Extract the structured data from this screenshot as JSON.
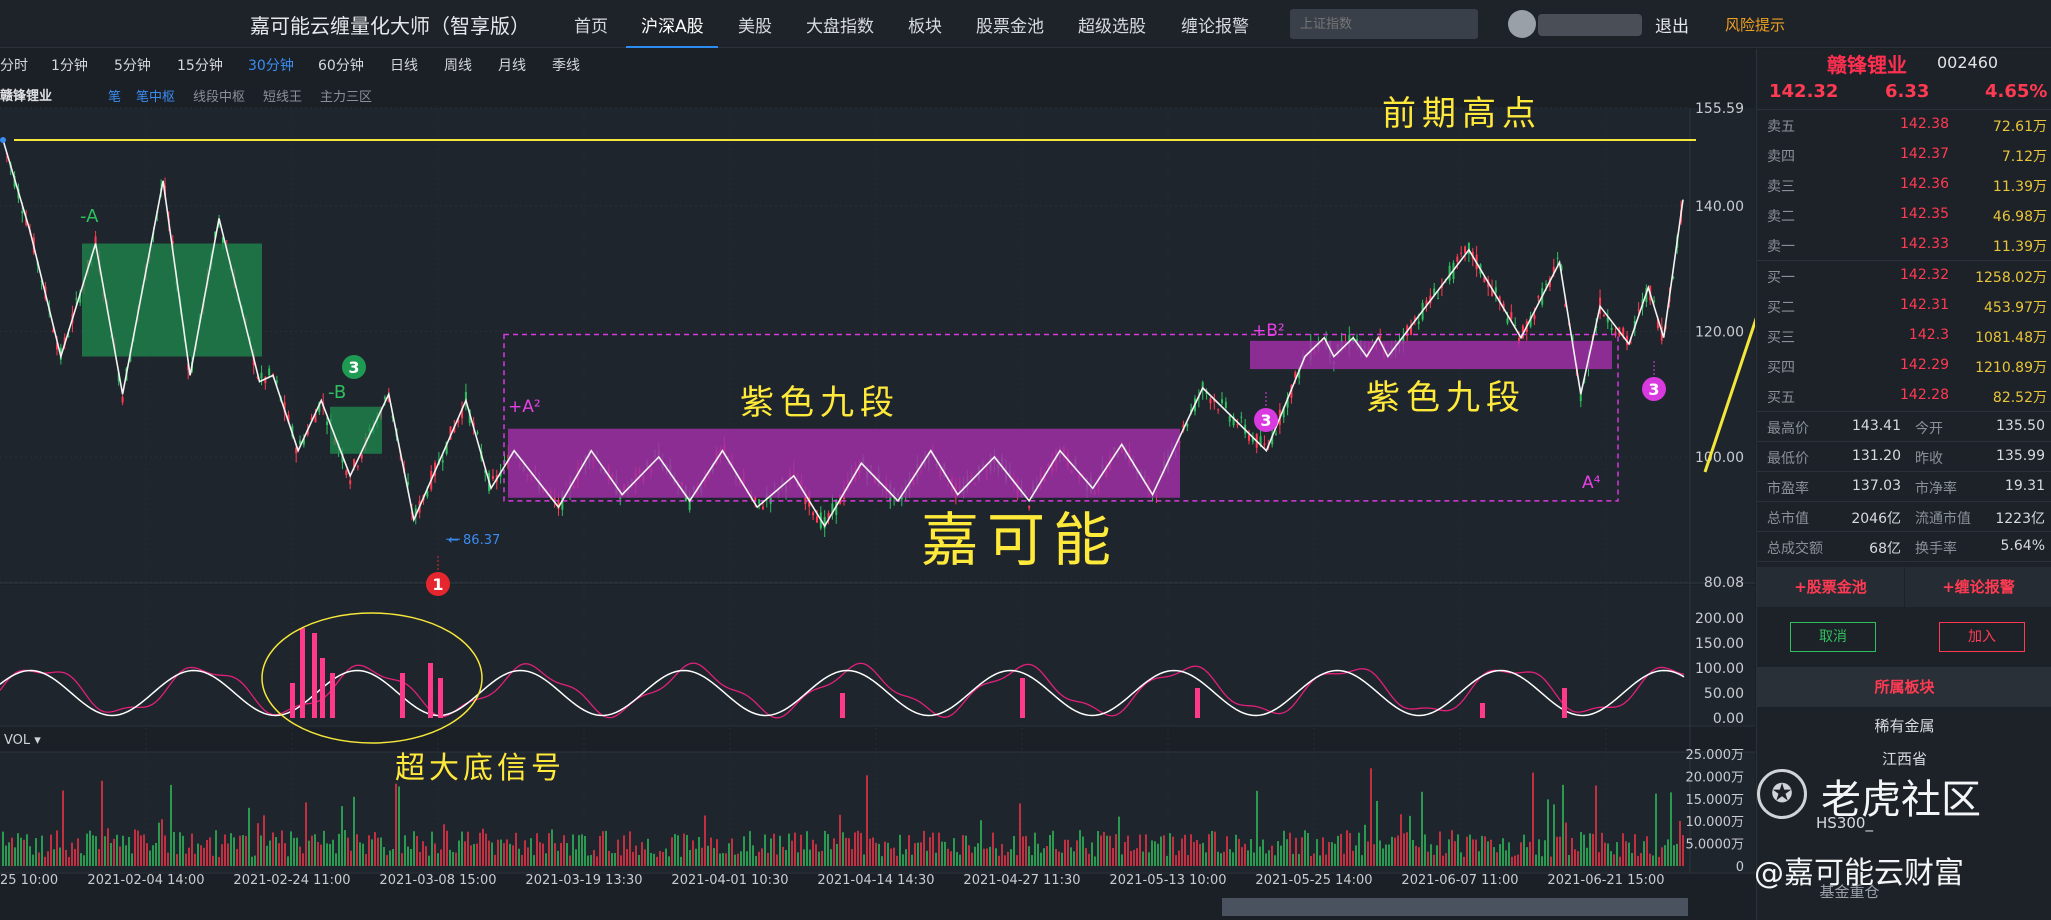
{
  "app": {
    "title": "嘉可能云缠量化大师（智享版）",
    "search_placeholder": "上证指数",
    "logout": "退出",
    "risk": "风险提示"
  },
  "nav": [
    "首页",
    "沪深A股",
    "美股",
    "大盘指数",
    "板块",
    "股票金池",
    "超级选股",
    "缠论报警"
  ],
  "periods": [
    "分时",
    "1分钟",
    "5分钟",
    "15分钟",
    "30分钟",
    "60分钟",
    "日线",
    "周线",
    "月线",
    "季线"
  ],
  "active_period": "30分钟",
  "chart_header": {
    "stock": "赣锋锂业",
    "indicators": [
      "笔",
      "笔中枢",
      "线段中枢",
      "短线王",
      "主力三区"
    ]
  },
  "chart_data": {
    "type": "candlestick",
    "x_ticks": [
      "25 10:00",
      "2021-02-04 14:00",
      "2021-02-24 11:00",
      "2021-03-08 15:00",
      "2021-03-19 13:30",
      "2021-04-01 10:30",
      "2021-04-14 14:30",
      "2021-04-27 11:30",
      "2021-05-13 10:00",
      "2021-05-25 14:00",
      "2021-06-07 11:00",
      "2021-06-21 15:00"
    ],
    "price_ticks": [
      "155.59",
      "140.00",
      "120.00",
      "100.00",
      "80.08"
    ],
    "price_range": [
      80.08,
      155.59
    ],
    "low_marker": "86.37",
    "indicator_ticks": [
      "200.00",
      "150.00",
      "100.00",
      "50.00",
      "0.00"
    ],
    "volume_label": "VOL",
    "volume_ticks": [
      "25.000万",
      "20.000万",
      "15.000万",
      "10.000万",
      "5.0000万",
      "0"
    ],
    "bi_line": [
      [
        0,
        150.5
      ],
      [
        14,
        136
      ],
      [
        30,
        116
      ],
      [
        48,
        134
      ],
      [
        62,
        110
      ],
      [
        83,
        144
      ],
      [
        97,
        113
      ],
      [
        112,
        138
      ],
      [
        133,
        112
      ],
      [
        140,
        113
      ],
      [
        153,
        101
      ],
      [
        165,
        109
      ],
      [
        180,
        97
      ],
      [
        200,
        110
      ],
      [
        213,
        90
      ],
      [
        240,
        109
      ],
      [
        253,
        95
      ],
      [
        265,
        101
      ],
      [
        288,
        92
      ],
      [
        305,
        101
      ],
      [
        321,
        94
      ],
      [
        340,
        100
      ],
      [
        356,
        93
      ],
      [
        373,
        101
      ],
      [
        391,
        92
      ],
      [
        410,
        97
      ],
      [
        426,
        89
      ],
      [
        445,
        99
      ],
      [
        464,
        93
      ],
      [
        481,
        101
      ],
      [
        495,
        94
      ],
      [
        514,
        100
      ],
      [
        532,
        93
      ],
      [
        548,
        101
      ],
      [
        565,
        95
      ],
      [
        580,
        102
      ],
      [
        596,
        94
      ],
      [
        622,
        111
      ],
      [
        655,
        101
      ],
      [
        675,
        116
      ],
      [
        685,
        119
      ],
      [
        690,
        116
      ],
      [
        700,
        119
      ],
      [
        707,
        116
      ],
      [
        713,
        119
      ],
      [
        718,
        116
      ],
      [
        760,
        133
      ],
      [
        787,
        119
      ],
      [
        807,
        131
      ],
      [
        818,
        110
      ],
      [
        828,
        124
      ],
      [
        843,
        118
      ],
      [
        853,
        127
      ],
      [
        861,
        119
      ],
      [
        871,
        141
      ]
    ],
    "bi_index_range": [
      0,
      871
    ],
    "annotations": {
      "title": "前期高点",
      "zone_a": "-A",
      "zone_b": "-B",
      "label_b2": "+B²",
      "label_a2": "+A²",
      "label_a4": "A⁴",
      "purple_text": "紫色九段",
      "brand": "嘉可能",
      "signal_text": "超大底信号"
    },
    "markers": [
      "1",
      "3",
      "3",
      "3"
    ]
  },
  "quote": {
    "name": "赣锋锂业",
    "code": "002460",
    "price": "142.32",
    "change": "6.33",
    "pct": "4.65%",
    "asks": [
      {
        "label": "卖五",
        "price": "142.38",
        "vol": "72.61万"
      },
      {
        "label": "卖四",
        "price": "142.37",
        "vol": "7.12万"
      },
      {
        "label": "卖三",
        "price": "142.36",
        "vol": "11.39万"
      },
      {
        "label": "卖二",
        "price": "142.35",
        "vol": "46.98万"
      },
      {
        "label": "卖一",
        "price": "142.33",
        "vol": "11.39万"
      }
    ],
    "bids": [
      {
        "label": "买一",
        "price": "142.32",
        "vol": "1258.02万"
      },
      {
        "label": "买二",
        "price": "142.31",
        "vol": "453.97万"
      },
      {
        "label": "买三",
        "price": "142.3",
        "vol": "1081.48万"
      },
      {
        "label": "买四",
        "price": "142.29",
        "vol": "1210.89万"
      },
      {
        "label": "买五",
        "price": "142.28",
        "vol": "82.52万"
      }
    ],
    "stats": [
      [
        "最高价",
        "143.41",
        "今开",
        "135.50"
      ],
      [
        "最低价",
        "131.20",
        "昨收",
        "135.99"
      ],
      [
        "市盈率",
        "137.03",
        "市净率",
        "19.31"
      ],
      [
        "总市值",
        "2046亿",
        "流通市值",
        "1223亿"
      ],
      [
        "总成交额",
        "68亿",
        "换手率",
        "5.64%"
      ]
    ],
    "btn_pool": "+股票金池",
    "btn_alarm": "+缠论报警",
    "btn_cancel": "取消",
    "btn_add": "加入",
    "sector_head": "所属板块",
    "sectors": [
      "稀有金属",
      "江西省",
      "HS300_"
    ],
    "fund": "基金重仓"
  },
  "watermark": {
    "text": "老虎社区",
    "sub": "@嘉可能云财富"
  },
  "colors": {
    "up": "#ff3a52",
    "down": "#2fbf5f",
    "accent": "#2d8cf0",
    "purple": "#a02fa6",
    "annot": "#ffe93a"
  }
}
